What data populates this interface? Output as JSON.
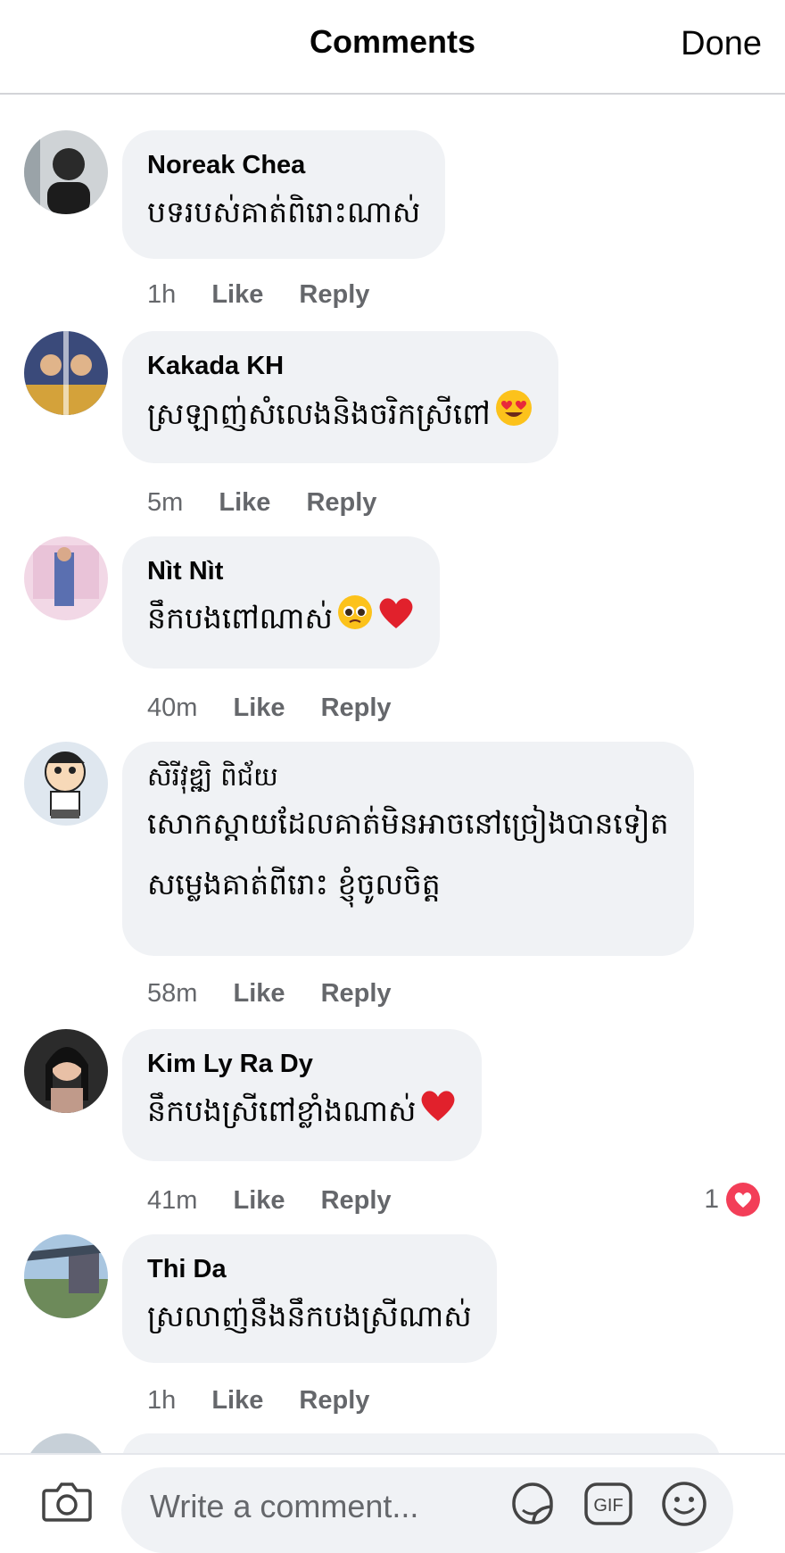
{
  "header": {
    "title": "Comments",
    "done_label": "Done"
  },
  "comments": [
    {
      "author": "Noreak Chea",
      "lines": [
        "បទរបស់គាត់ពិរោះណាស់"
      ],
      "time": "1h",
      "like": "Like",
      "reply": "Reply"
    },
    {
      "author": "Kakada KH",
      "lines": [
        "ស្រឡាញ់សំលេងនិងចរិកស្រីពៅ"
      ],
      "emoji": "heart-eyes-emoji",
      "time": "5m",
      "like": "Like",
      "reply": "Reply"
    },
    {
      "author": "Nìt Nìt",
      "lines": [
        "នឹកបងពៅណាស់"
      ],
      "emoji": "pleading-face-emoji + red-heart-emoji",
      "time": "40m",
      "like": "Like",
      "reply": "Reply"
    },
    {
      "author": "សិរីវុឌ្ឍិ ពិជ័យ",
      "lines": [
        "សោកស្តាយដែលគាត់មិនអាចនៅច្រៀងបានទៀត",
        "សម្លេងគាត់ពីរោះ ខ្ញុំចូលចិត្ត"
      ],
      "time": "58m",
      "like": "Like",
      "reply": "Reply"
    },
    {
      "author": "Kim Ly Ra Dy",
      "lines": [
        "នឹកបងស្រីពៅខ្លាំងណាស់"
      ],
      "emoji": "red-heart-emoji",
      "time": "41m",
      "like": "Like",
      "reply": "Reply",
      "reaction_count": "1"
    },
    {
      "author": "Thi Da",
      "lines": [
        "ស្រលាញ់នឹងនឹកបងស្រីណាស់"
      ],
      "time": "1h",
      "like": "Like",
      "reply": "Reply"
    }
  ],
  "footer": {
    "placeholder": "Write a comment...",
    "icons": [
      "camera-icon",
      "sticker-icon",
      "gif-icon",
      "smile-icon"
    ]
  },
  "colors": {
    "bubble": "#f0f2f5",
    "secondary_text": "#65676b",
    "reaction_heart": "#f33e58"
  }
}
